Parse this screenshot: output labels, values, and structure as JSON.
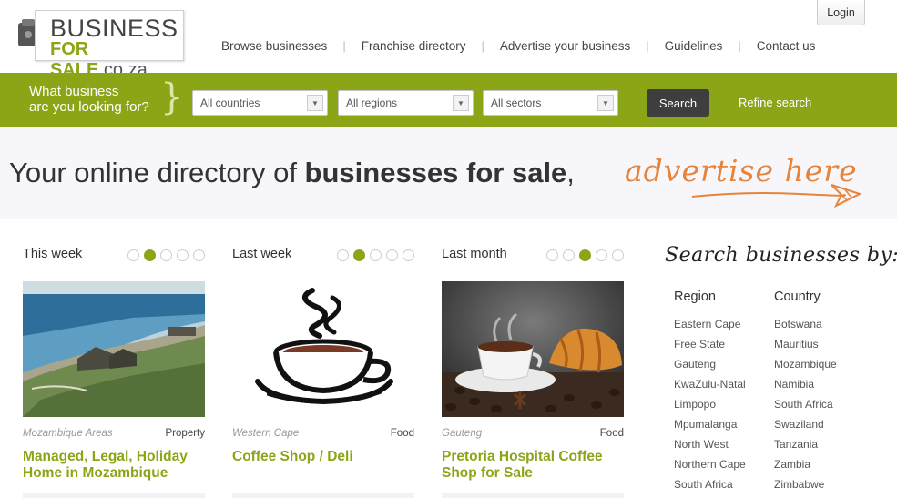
{
  "header": {
    "logo": {
      "line1": "BUSINESS",
      "line2_brand": "FOR SALE",
      "line2_domain": ".co.za"
    },
    "login_label": "Login",
    "nav": [
      "Browse businesses",
      "Franchise directory",
      "Advertise your business",
      "Guidelines",
      "Contact us"
    ]
  },
  "searchbar": {
    "question_line1": "What business",
    "question_line2": "are you looking for?",
    "brace": "}",
    "countries": "All countries",
    "regions": "All regions",
    "sectors": "All sectors",
    "search_label": "Search",
    "refine_label": "Refine search"
  },
  "banner": {
    "text_prefix": "Your online directory of ",
    "text_bold": "businesses for sale",
    "text_suffix": ",",
    "cta": "advertise here"
  },
  "columns": [
    {
      "title": "This week",
      "location": "Mozambique Areas",
      "category": "Property",
      "listing": "Managed, Legal, Holiday Home in Mozambique",
      "active_dot": 2
    },
    {
      "title": "Last week",
      "location": "Western Cape",
      "category": "Food",
      "listing": "Coffee Shop / Deli",
      "active_dot": 2
    },
    {
      "title": "Last month",
      "location": "Gauteng",
      "category": "Food",
      "listing": "Pretoria Hospital Coffee Shop for Sale",
      "active_dot": 3
    }
  ],
  "sidebar": {
    "heading": "Search businesses by:",
    "region_title": "Region",
    "regions": [
      "Eastern Cape",
      "Free State",
      "Gauteng",
      "KwaZulu-Natal",
      "Limpopo",
      "Mpumalanga",
      "North West",
      "Northern Cape",
      "South Africa"
    ],
    "country_title": "Country",
    "countries": [
      "Botswana",
      "Mauritius",
      "Mozambique",
      "Namibia",
      "South Africa",
      "Swaziland",
      "Tanzania",
      "Zambia",
      "Zimbabwe"
    ]
  },
  "colors": {
    "brand_green": "#8aa617",
    "accent_orange": "#e8843a",
    "dark_button": "#3e3e3e"
  }
}
